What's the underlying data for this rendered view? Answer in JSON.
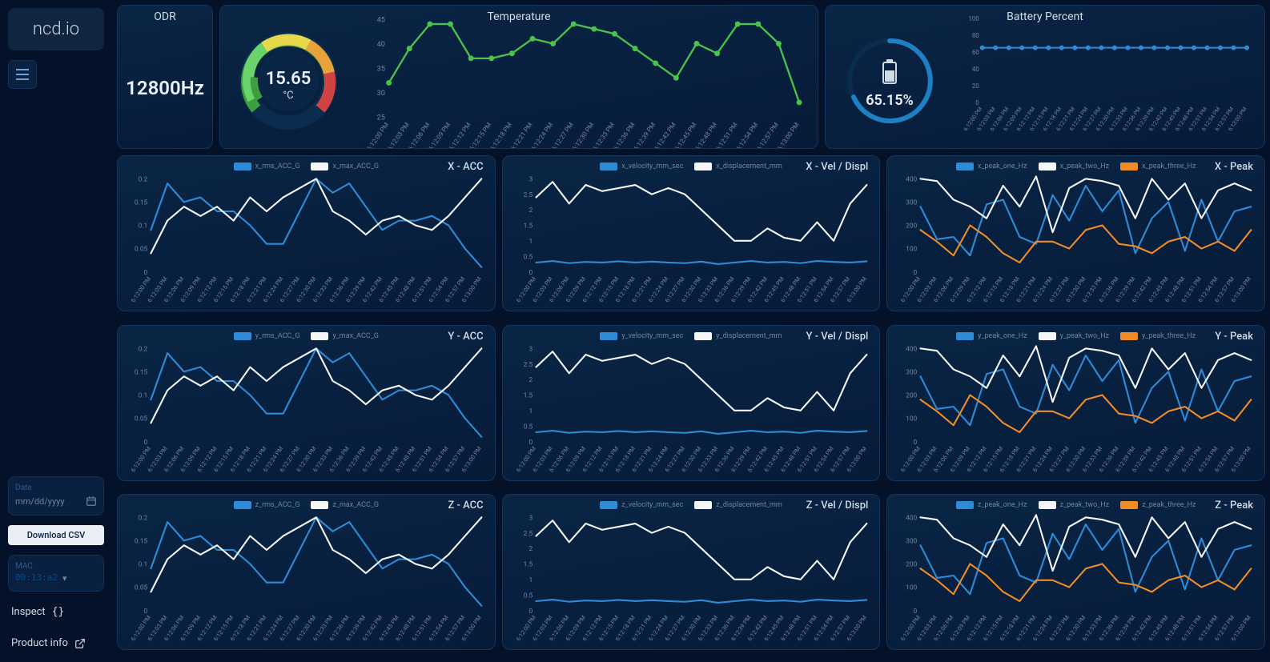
{
  "sidebar": {
    "logo": "ncd.io",
    "date_label": "Date",
    "date_placeholder": "mm/dd/yyyy",
    "download_csv": "Download CSV",
    "mac_label": "MAC",
    "mac_value": "00:13:a2",
    "inspect": "Inspect",
    "product_info": "Product info"
  },
  "top": {
    "odr_title": "ODR",
    "odr_value": "12800Hz",
    "temperature_title": "Temperature",
    "temperature_gauge_value": "15.65",
    "temperature_gauge_unit": "°C",
    "battery_title": "Battery Percent",
    "battery_gauge_value": "65.15%"
  },
  "chart_titles": {
    "x_acc": "X - ACC",
    "y_acc": "Y - ACC",
    "z_acc": "Z - ACC",
    "x_vel": "X - Vel / Displ",
    "y_vel": "Y - Vel / Displ",
    "z_vel": "Z - Vel / Displ",
    "x_peak": "X - Peak",
    "y_peak": "Y - Peak",
    "z_peak": "Z - Peak"
  },
  "legend_labels": {
    "acc": [
      "x_rms_ACC_G",
      "x_max_ACC_G"
    ],
    "acc_y": [
      "y_rms_ACC_G",
      "y_max_ACC_G"
    ],
    "acc_z": [
      "z_rms_ACC_G",
      "z_max_ACC_G"
    ],
    "vel": [
      "x_velocity_mm_sec",
      "x_displacement_mm"
    ],
    "vel_y": [
      "y_velocity_mm_sec",
      "y_displacement_mm"
    ],
    "vel_z": [
      "z_velocity_mm_sec",
      "z_displacement_mm"
    ],
    "peak": [
      "x_peak_one_Hz",
      "x_peak_two_Hz",
      "x_peak_three_Hz"
    ],
    "peak_y": [
      "y_peak_one_Hz",
      "y_peak_two_Hz",
      "y_peak_three_Hz"
    ],
    "peak_z": [
      "z_peak_one_Hz",
      "z_peak_two_Hz",
      "z_peak_three_Hz"
    ]
  },
  "time_categories": [
    "6:12:00 PM",
    "6:12:03 PM",
    "6:12:06 PM",
    "6:12:09 PM",
    "6:12:12 PM",
    "6:12:15 PM",
    "6:12:18 PM",
    "6:12:21 PM",
    "6:12:24 PM",
    "6:12:27 PM",
    "6:12:30 PM",
    "6:12:33 PM",
    "6:12:36 PM",
    "6:12:39 PM",
    "6:12:42 PM",
    "6:12:45 PM",
    "6:12:48 PM",
    "6:12:51 PM",
    "6:12:54 PM",
    "6:12:57 PM",
    "6:13:00 PM"
  ],
  "chart_data": [
    {
      "id": "temperature",
      "type": "line",
      "title": "Temperature",
      "xlabel": "",
      "ylabel": "",
      "ylim": [
        25,
        45
      ],
      "yticks": [
        25,
        30,
        35,
        40,
        45
      ],
      "series": [
        {
          "name": "temperature_C",
          "color": "#4bc24b",
          "dots": true,
          "values": [
            32,
            39,
            44,
            44,
            37,
            37,
            38,
            41,
            40,
            44,
            43,
            42,
            39,
            36,
            33,
            40,
            38,
            44,
            44,
            40,
            28
          ]
        }
      ]
    },
    {
      "id": "battery",
      "type": "line",
      "title": "Battery Percent",
      "xlabel": "",
      "ylabel": "",
      "ylim": [
        0,
        100
      ],
      "yticks": [
        0,
        20,
        40,
        60,
        80,
        100
      ],
      "series": [
        {
          "name": "battery_pct",
          "color": "#2e8bd8",
          "dots": true,
          "values": [
            65,
            65,
            65,
            65,
            65,
            65,
            65,
            65,
            65,
            65,
            65,
            65,
            65,
            65,
            65,
            65,
            65,
            65,
            65,
            65,
            65
          ]
        }
      ]
    },
    {
      "id": "x_acc",
      "type": "line",
      "title": "X - ACC",
      "ylim": [
        0,
        0.2
      ],
      "yticks": [
        0,
        0.05,
        0.1,
        0.15,
        0.2
      ],
      "series": [
        {
          "name": "x_rms_ACC_G",
          "color": "#2e8bd8",
          "values": [
            0.09,
            0.19,
            0.15,
            0.16,
            0.13,
            0.13,
            0.1,
            0.06,
            0.06,
            0.13,
            0.2,
            0.17,
            0.19,
            0.14,
            0.09,
            0.11,
            0.11,
            0.12,
            0.1,
            0.05,
            0.01
          ]
        },
        {
          "name": "x_max_ACC_G",
          "color": "#f4f6f8",
          "values": [
            0.04,
            0.11,
            0.14,
            0.12,
            0.14,
            0.11,
            0.16,
            0.13,
            0.16,
            0.18,
            0.2,
            0.13,
            0.11,
            0.08,
            0.11,
            0.12,
            0.1,
            0.09,
            0.12,
            0.16,
            0.2
          ]
        }
      ]
    },
    {
      "id": "x_vel",
      "type": "line",
      "title": "X - Vel / Displ",
      "ylim": [
        0,
        3.0
      ],
      "yticks": [
        0,
        0.5,
        1.0,
        1.5,
        2.0,
        2.5,
        3.0
      ],
      "series": [
        {
          "name": "x_velocity_mm_sec",
          "color": "#2e8bd8",
          "values": [
            0.3,
            0.35,
            0.28,
            0.32,
            0.3,
            0.34,
            0.3,
            0.33,
            0.3,
            0.28,
            0.33,
            0.25,
            0.3,
            0.35,
            0.3,
            0.32,
            0.28,
            0.35,
            0.32,
            0.3,
            0.34
          ]
        },
        {
          "name": "x_displacement_mm",
          "color": "#f4f6f8",
          "values": [
            2.4,
            2.9,
            2.2,
            2.8,
            2.6,
            2.7,
            2.8,
            2.5,
            2.7,
            2.5,
            2.0,
            1.5,
            1.0,
            1.0,
            1.4,
            1.1,
            1.0,
            1.6,
            1.0,
            2.2,
            2.8
          ]
        }
      ]
    },
    {
      "id": "x_peak",
      "type": "line",
      "title": "X - Peak",
      "ylim": [
        0,
        400
      ],
      "yticks": [
        0,
        100,
        200,
        300,
        400
      ],
      "series": [
        {
          "name": "x_peak_one_Hz",
          "color": "#2e8bd8",
          "values": [
            280,
            140,
            150,
            70,
            290,
            310,
            150,
            120,
            330,
            220,
            370,
            260,
            350,
            80,
            230,
            300,
            90,
            310,
            130,
            260,
            280
          ]
        },
        {
          "name": "x_peak_two_Hz",
          "color": "#f4f6f8",
          "values": [
            400,
            390,
            310,
            280,
            230,
            370,
            280,
            410,
            170,
            360,
            400,
            390,
            370,
            230,
            400,
            310,
            380,
            230,
            350,
            380,
            350
          ]
        },
        {
          "name": "x_peak_three_Hz",
          "color": "#f08c28",
          "values": [
            180,
            130,
            70,
            200,
            150,
            80,
            40,
            130,
            130,
            100,
            180,
            200,
            120,
            110,
            80,
            130,
            150,
            100,
            130,
            90,
            180
          ]
        }
      ]
    },
    {
      "id": "y_acc",
      "type": "line",
      "title": "Y - ACC",
      "ylim": [
        0,
        0.2
      ],
      "yticks": [
        0,
        0.05,
        0.1,
        0.15,
        0.2
      ],
      "series": [
        {
          "name": "y_rms_ACC_G",
          "color": "#2e8bd8",
          "values": [
            0.09,
            0.19,
            0.15,
            0.16,
            0.13,
            0.13,
            0.1,
            0.06,
            0.06,
            0.13,
            0.2,
            0.17,
            0.19,
            0.14,
            0.09,
            0.11,
            0.11,
            0.12,
            0.1,
            0.05,
            0.01
          ]
        },
        {
          "name": "y_max_ACC_G",
          "color": "#f4f6f8",
          "values": [
            0.04,
            0.11,
            0.14,
            0.12,
            0.14,
            0.11,
            0.16,
            0.13,
            0.16,
            0.18,
            0.2,
            0.13,
            0.11,
            0.08,
            0.11,
            0.12,
            0.1,
            0.09,
            0.12,
            0.16,
            0.2
          ]
        }
      ]
    },
    {
      "id": "y_vel",
      "type": "line",
      "title": "Y - Vel / Displ",
      "ylim": [
        0,
        3.0
      ],
      "yticks": [
        0,
        0.5,
        1.0,
        1.5,
        2.0,
        2.5,
        3.0
      ],
      "series": [
        {
          "name": "y_velocity_mm_sec",
          "color": "#2e8bd8",
          "values": [
            0.3,
            0.35,
            0.28,
            0.32,
            0.3,
            0.34,
            0.3,
            0.33,
            0.3,
            0.28,
            0.33,
            0.25,
            0.3,
            0.35,
            0.3,
            0.32,
            0.28,
            0.35,
            0.32,
            0.3,
            0.34
          ]
        },
        {
          "name": "y_displacement_mm",
          "color": "#f4f6f8",
          "values": [
            2.4,
            2.9,
            2.2,
            2.8,
            2.6,
            2.7,
            2.8,
            2.5,
            2.7,
            2.5,
            2.0,
            1.5,
            1.0,
            1.0,
            1.4,
            1.1,
            1.0,
            1.6,
            1.0,
            2.2,
            2.8
          ]
        }
      ]
    },
    {
      "id": "y_peak",
      "type": "line",
      "title": "Y - Peak",
      "ylim": [
        0,
        400
      ],
      "yticks": [
        0,
        100,
        200,
        300,
        400
      ],
      "series": [
        {
          "name": "y_peak_one_Hz",
          "color": "#2e8bd8",
          "values": [
            280,
            140,
            150,
            70,
            290,
            310,
            150,
            120,
            330,
            220,
            370,
            260,
            350,
            80,
            230,
            300,
            90,
            310,
            130,
            260,
            280
          ]
        },
        {
          "name": "y_peak_two_Hz",
          "color": "#f4f6f8",
          "values": [
            400,
            390,
            310,
            280,
            230,
            370,
            280,
            410,
            170,
            360,
            400,
            390,
            370,
            230,
            400,
            310,
            380,
            230,
            350,
            380,
            350
          ]
        },
        {
          "name": "y_peak_three_Hz",
          "color": "#f08c28",
          "values": [
            180,
            130,
            70,
            200,
            150,
            80,
            40,
            130,
            130,
            100,
            180,
            200,
            120,
            110,
            80,
            130,
            150,
            100,
            130,
            90,
            180
          ]
        }
      ]
    },
    {
      "id": "z_acc",
      "type": "line",
      "title": "Z - ACC",
      "ylim": [
        0,
        0.2
      ],
      "yticks": [
        0,
        0.05,
        0.1,
        0.15,
        0.2
      ],
      "series": [
        {
          "name": "z_rms_ACC_G",
          "color": "#2e8bd8",
          "values": [
            0.09,
            0.19,
            0.15,
            0.16,
            0.13,
            0.13,
            0.1,
            0.06,
            0.06,
            0.13,
            0.2,
            0.17,
            0.19,
            0.14,
            0.09,
            0.11,
            0.11,
            0.12,
            0.1,
            0.05,
            0.01
          ]
        },
        {
          "name": "z_max_ACC_G",
          "color": "#f4f6f8",
          "values": [
            0.04,
            0.11,
            0.14,
            0.12,
            0.14,
            0.11,
            0.16,
            0.13,
            0.16,
            0.18,
            0.2,
            0.13,
            0.11,
            0.08,
            0.11,
            0.12,
            0.1,
            0.09,
            0.12,
            0.16,
            0.2
          ]
        }
      ]
    },
    {
      "id": "z_vel",
      "type": "line",
      "title": "Z - Vel / Displ",
      "ylim": [
        0,
        3.0
      ],
      "yticks": [
        0,
        0.5,
        1.0,
        1.5,
        2.0,
        2.5,
        3.0
      ],
      "series": [
        {
          "name": "z_velocity_mm_sec",
          "color": "#2e8bd8",
          "values": [
            0.3,
            0.35,
            0.28,
            0.32,
            0.3,
            0.34,
            0.3,
            0.33,
            0.3,
            0.28,
            0.33,
            0.25,
            0.3,
            0.35,
            0.3,
            0.32,
            0.28,
            0.35,
            0.32,
            0.3,
            0.34
          ]
        },
        {
          "name": "z_displacement_mm",
          "color": "#f4f6f8",
          "values": [
            2.4,
            2.9,
            2.2,
            2.8,
            2.6,
            2.7,
            2.8,
            2.5,
            2.7,
            2.5,
            2.0,
            1.5,
            1.0,
            1.0,
            1.4,
            1.1,
            1.0,
            1.6,
            1.0,
            2.2,
            2.8
          ]
        }
      ]
    },
    {
      "id": "z_peak",
      "type": "line",
      "title": "Z - Peak",
      "ylim": [
        0,
        400
      ],
      "yticks": [
        0,
        100,
        200,
        300,
        400
      ],
      "series": [
        {
          "name": "z_peak_one_Hz",
          "color": "#2e8bd8",
          "values": [
            280,
            140,
            150,
            70,
            290,
            310,
            150,
            120,
            330,
            220,
            370,
            260,
            350,
            80,
            230,
            300,
            90,
            310,
            130,
            260,
            280
          ]
        },
        {
          "name": "z_peak_two_Hz",
          "color": "#f4f6f8",
          "values": [
            400,
            390,
            310,
            280,
            230,
            370,
            280,
            410,
            170,
            360,
            400,
            390,
            370,
            230,
            400,
            310,
            380,
            230,
            350,
            380,
            350
          ]
        },
        {
          "name": "z_peak_three_Hz",
          "color": "#f08c28",
          "values": [
            180,
            130,
            70,
            200,
            150,
            80,
            40,
            130,
            130,
            100,
            180,
            200,
            120,
            110,
            80,
            130,
            150,
            100,
            130,
            90,
            180
          ]
        }
      ]
    }
  ]
}
